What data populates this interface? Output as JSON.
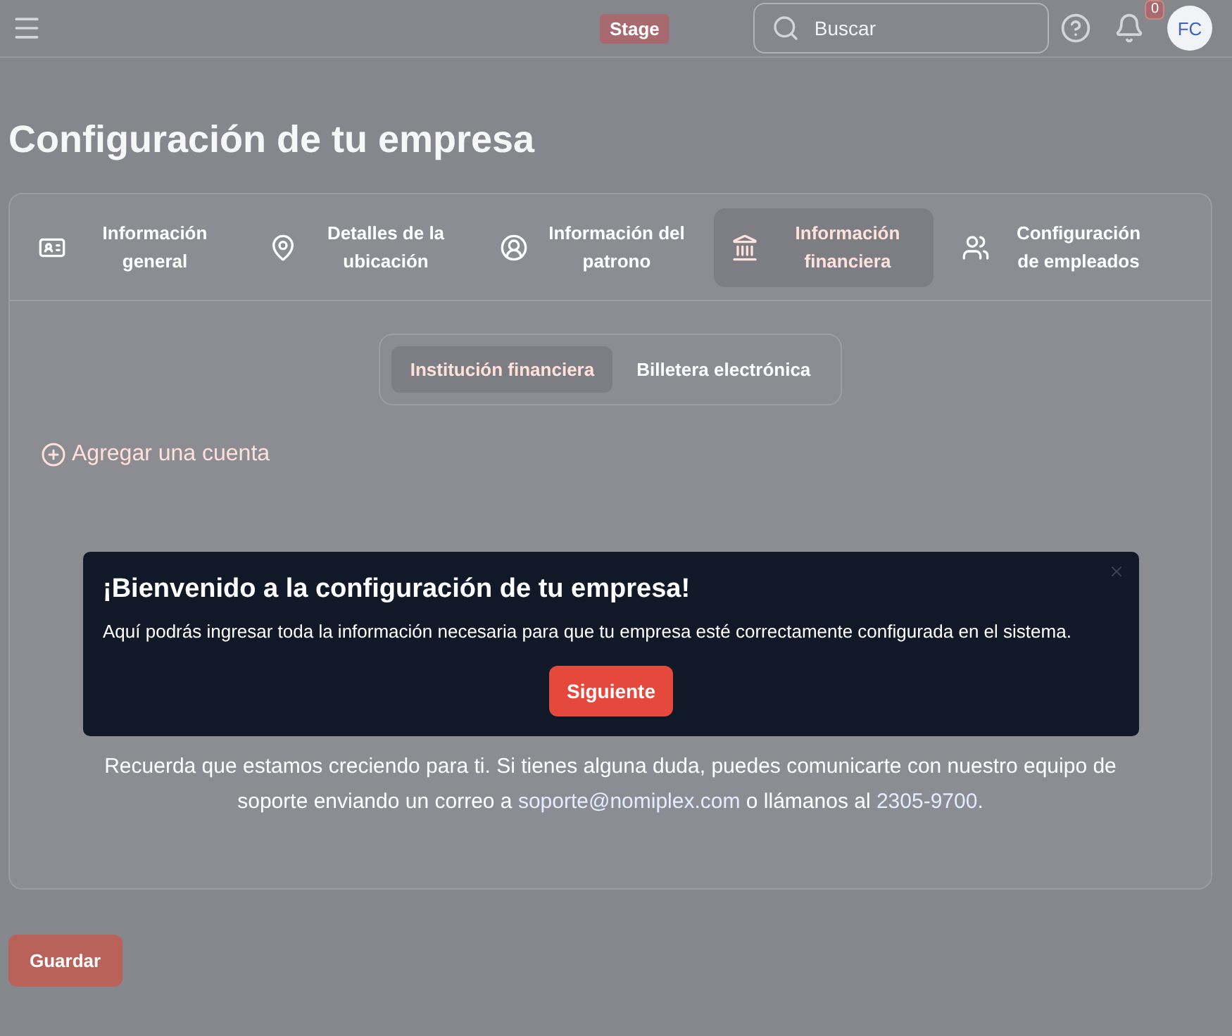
{
  "header": {
    "badge": "Stage",
    "search": {
      "placeholder": "Buscar"
    },
    "notifications": "0",
    "avatar": "FC"
  },
  "title": "Configuración de tu empresa",
  "tabs": [
    {
      "label": "Información general",
      "selected": false
    },
    {
      "label": "Detalles de la ubicación",
      "selected": false
    },
    {
      "label": "Información del patrono",
      "selected": false
    },
    {
      "label": "Información financiera",
      "selected": true
    },
    {
      "label": "Configuración de empleados",
      "selected": false
    }
  ],
  "subtabs": [
    {
      "label": "Institución financiera",
      "selected": true
    },
    {
      "label": "Billetera electrónica",
      "selected": false
    }
  ],
  "add_account": "Agregar una cuenta",
  "support": {
    "before": "Recuerda que estamos creciendo para ti. Si tienes alguna duda, puedes comunicarte con nuestro equipo de soporte enviando un correo a",
    "email": "soporte@nomiplex.com",
    "middle": "o llámanos al",
    "phone": "2305-9700",
    "after": "."
  },
  "save": "Guardar",
  "popup": {
    "title": "¡Bienvenido a la configuración de tu empresa!",
    "body": "Aquí podrás ingresar toda la información necesaria para que tu empresa esté correctamente configurada en el sistema.",
    "button": "Siguiente"
  }
}
